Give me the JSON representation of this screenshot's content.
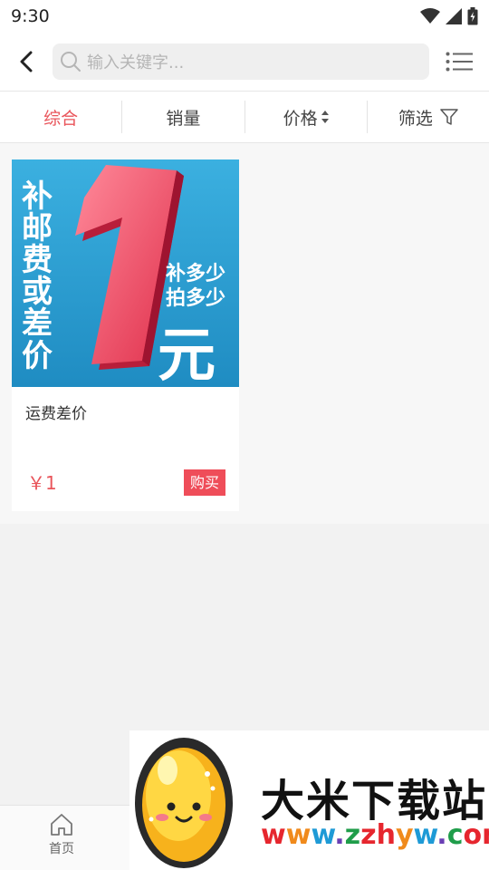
{
  "status_bar": {
    "time": "9:30"
  },
  "search": {
    "placeholder": "输入关键字..."
  },
  "sort_tabs": [
    {
      "label": "综合"
    },
    {
      "label": "销量"
    },
    {
      "label": "价格"
    },
    {
      "label": "筛选"
    }
  ],
  "product": {
    "title": "运费差价",
    "price": "￥1",
    "buy_label": "购买",
    "image": {
      "vertical_text": [
        "补",
        "邮",
        "费",
        "或",
        "差",
        "价"
      ],
      "big_number": "1",
      "line1": "补多少",
      "line2": "拍多少",
      "unit": "元"
    }
  },
  "bottom_nav": {
    "home_label": "首页"
  },
  "watermark": {
    "title": "大米下载站",
    "url": "www.zzhyw.com"
  },
  "colors": {
    "accent": "#e9555b",
    "buy_button": "#ef4d59",
    "image_bg": "#2a9fd0",
    "number_red": "#e8405a"
  }
}
